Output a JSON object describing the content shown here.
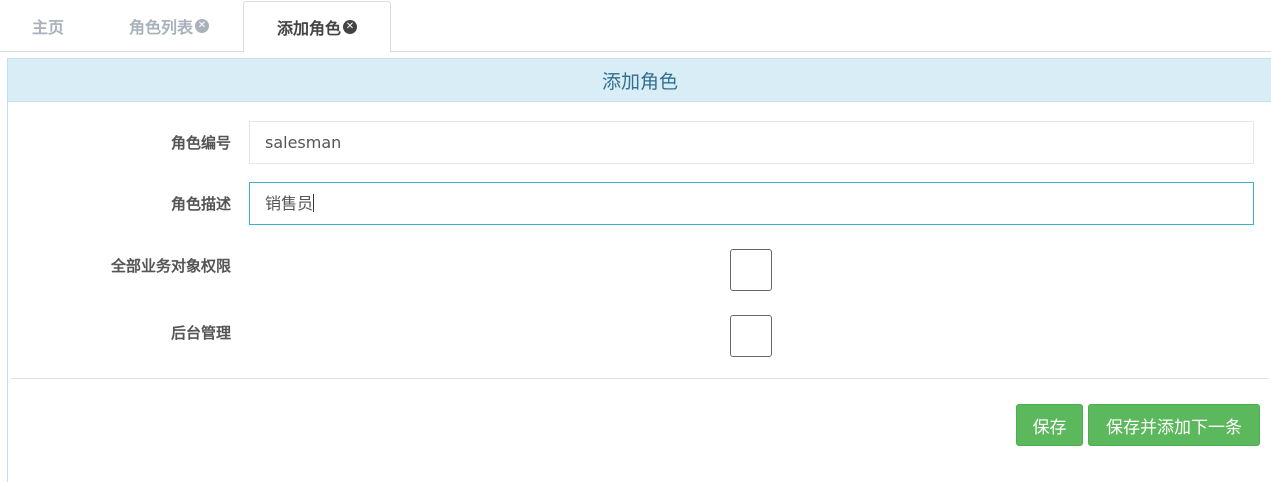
{
  "tabs": [
    {
      "label": "主页",
      "closable": false
    },
    {
      "label": "角色列表",
      "closable": true
    },
    {
      "label": "添加角色",
      "closable": true,
      "active": true
    }
  ],
  "panel": {
    "title": "添加角色"
  },
  "form": {
    "role_code": {
      "label": "角色编号",
      "value": "salesman"
    },
    "role_desc": {
      "label": "角色描述",
      "value": "销售员"
    },
    "all_business_permission": {
      "label": "全部业务对象权限",
      "checked": false
    },
    "backend_admin": {
      "label": "后台管理",
      "checked": false
    }
  },
  "buttons": {
    "save": "保存",
    "save_and_next": "保存并添加下一条"
  },
  "colors": {
    "panel_heading_bg": "#d9edf7",
    "panel_heading_text": "#31708f",
    "button_green": "#5cb85c",
    "focus_border": "#3bb3c3"
  },
  "icons": {
    "tab_close": "close-circle-icon"
  }
}
